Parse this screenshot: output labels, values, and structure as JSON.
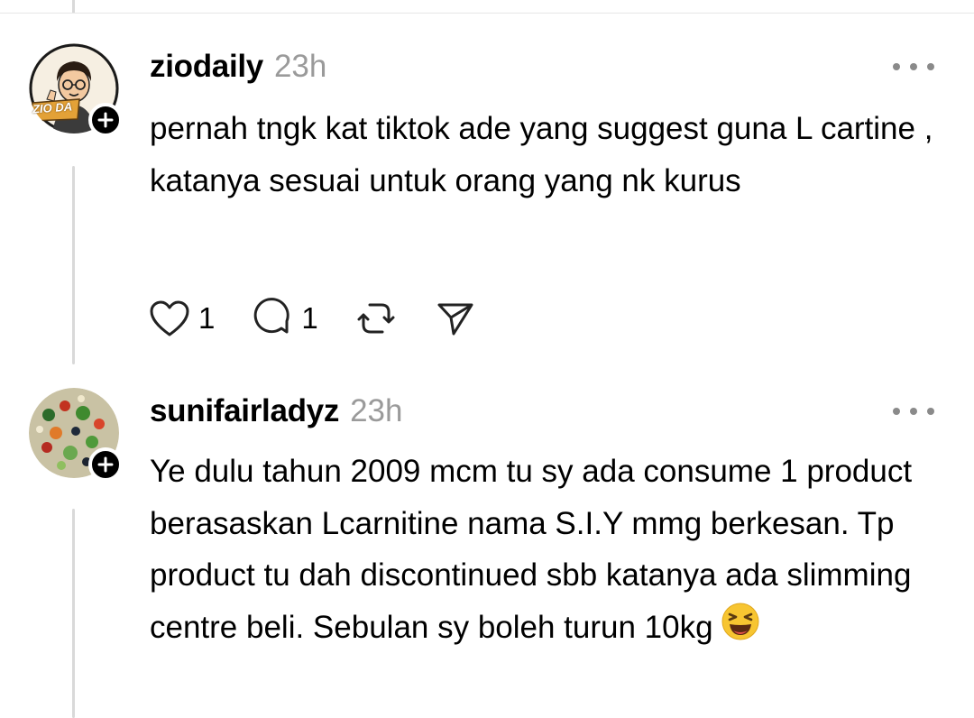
{
  "posts": [
    {
      "username": "ziodaily",
      "time": "23h",
      "avatar_text": "ZIO DA",
      "text": "pernah tngk kat tiktok ade yang suggest guna L cartine , katanya sesuai untuk orang yang nk kurus",
      "likes": "1",
      "replies": "1"
    },
    {
      "username": "sunifairladyz",
      "time": "23h",
      "text": "Ye dulu tahun 2009 mcm tu sy ada consume 1 product berasaskan Lcarnitine nama S.I.Y mmg berkesan. Tp product tu dah discontinued sbb katanya ada slimming centre beli. Sebulan sy boleh turun 10kg",
      "emoji": "laughing-face-emoji"
    }
  ],
  "icons": {
    "follow": "plus-icon",
    "more": "more-options-icon",
    "like": "heart-icon",
    "reply": "comment-icon",
    "repost": "repost-icon",
    "share": "send-icon"
  },
  "colors": {
    "text": "#000000",
    "muted": "#9a9a9a",
    "thread_line": "#d9d9d9"
  }
}
